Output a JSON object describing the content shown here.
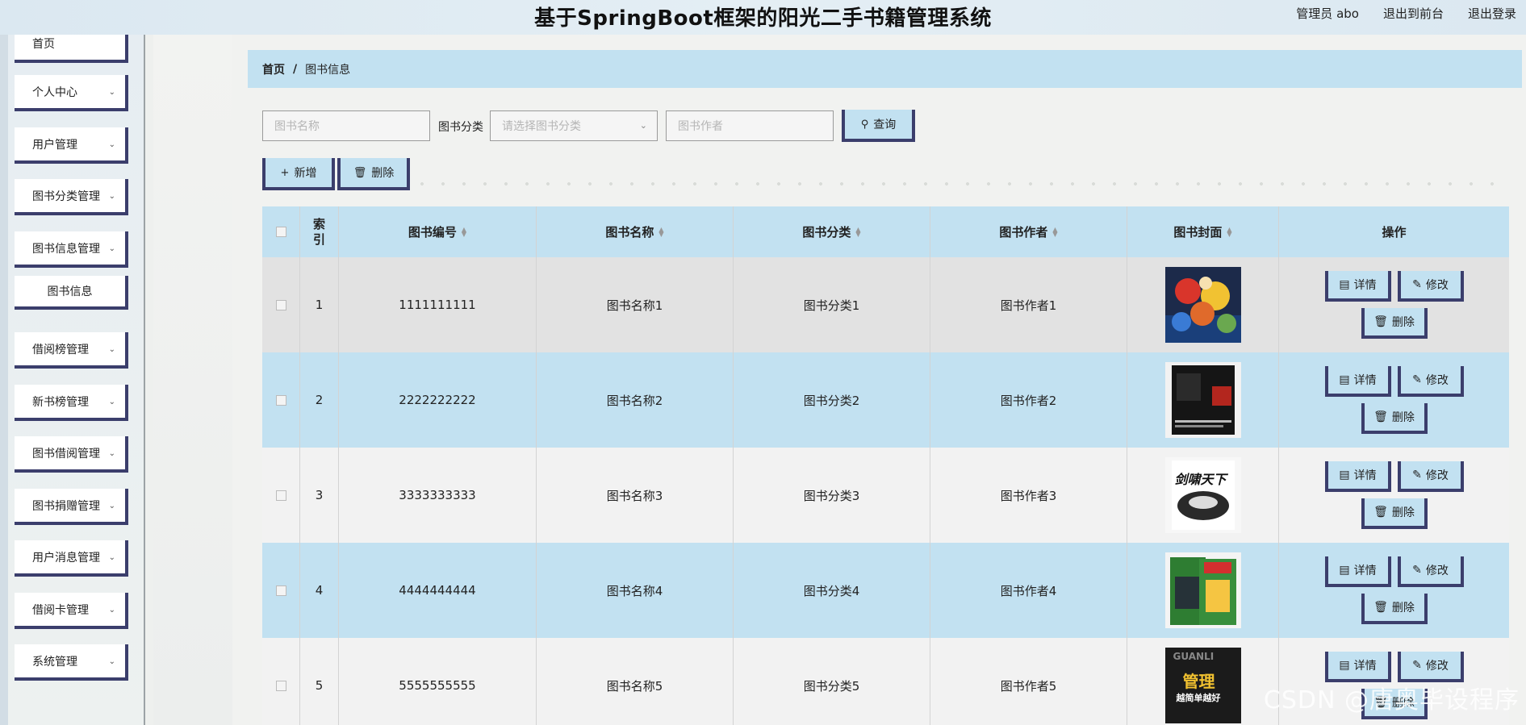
{
  "header": {
    "title": "基于SpringBoot框架的阳光二手书籍管理系统",
    "user": "管理员 abo",
    "exit_front": "退出到前台",
    "logout": "退出登录"
  },
  "sidebar": {
    "items": [
      {
        "label": "首页",
        "has_chevron": false
      },
      {
        "label": "个人中心",
        "has_chevron": true
      },
      {
        "label": "用户管理",
        "has_chevron": true
      },
      {
        "label": "图书分类管理",
        "has_chevron": true
      },
      {
        "label": "图书信息管理",
        "has_chevron": true
      },
      {
        "label": "图书信息",
        "sub": true
      },
      {
        "label": "借阅榜管理",
        "has_chevron": true
      },
      {
        "label": "新书榜管理",
        "has_chevron": true
      },
      {
        "label": "图书借阅管理",
        "has_chevron": true
      },
      {
        "label": "图书捐赠管理",
        "has_chevron": true
      },
      {
        "label": "用户消息管理",
        "has_chevron": true
      },
      {
        "label": "借阅卡管理",
        "has_chevron": true
      },
      {
        "label": "系统管理",
        "has_chevron": true
      }
    ]
  },
  "breadcrumb": {
    "home": "首页",
    "sep": "/",
    "current": "图书信息"
  },
  "search": {
    "name_placeholder": "图书名称",
    "category_label": "图书分类",
    "category_placeholder": "请选择图书分类",
    "author_placeholder": "图书作者",
    "query_label": "查询"
  },
  "actions": {
    "add_label": "新增",
    "delete_label": "删除"
  },
  "table": {
    "headers": {
      "index": "索引",
      "code": "图书编号",
      "name": "图书名称",
      "category": "图书分类",
      "author": "图书作者",
      "cover": "图书封面",
      "ops": "操作"
    },
    "rows": [
      {
        "index": "1",
        "code": "1111111111",
        "name": "图书名称1",
        "category": "图书分类1",
        "author": "图书作者1"
      },
      {
        "index": "2",
        "code": "2222222222",
        "name": "图书名称2",
        "category": "图书分类2",
        "author": "图书作者2"
      },
      {
        "index": "3",
        "code": "3333333333",
        "name": "图书名称3",
        "category": "图书分类3",
        "author": "图书作者3"
      },
      {
        "index": "4",
        "code": "4444444444",
        "name": "图书名称4",
        "category": "图书分类4",
        "author": "图书作者4"
      },
      {
        "index": "5",
        "code": "5555555555",
        "name": "图书名称5",
        "category": "图书分类5",
        "author": "图书作者5"
      }
    ],
    "op_labels": {
      "detail": "详情",
      "edit": "修改",
      "delete": "删除"
    }
  },
  "covers": {
    "cover3_text": "剑啸天下",
    "cover5_text_top": "GUANLI",
    "cover5_text_main": "管理",
    "cover5_text_sub": "越简单越好"
  },
  "watermark": "CSDN @唐奥毕设程序"
}
